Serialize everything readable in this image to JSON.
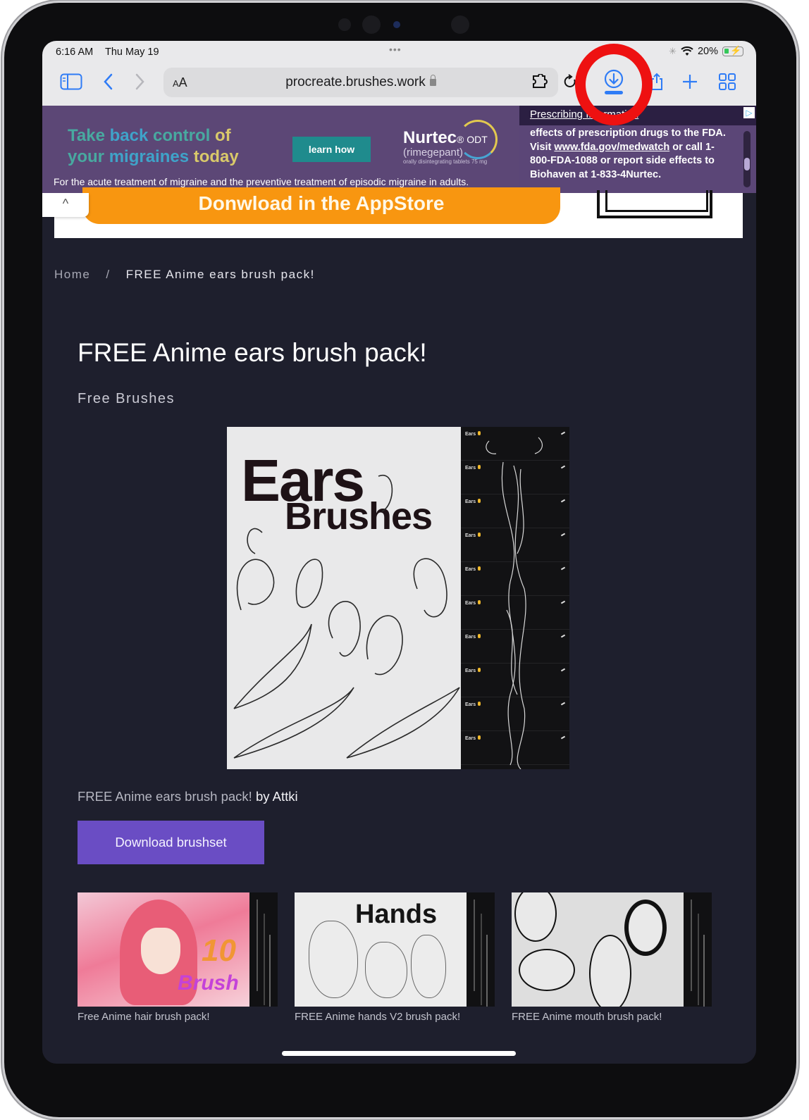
{
  "status_bar": {
    "time": "6:16 AM",
    "date": "Thu May 19",
    "battery_percent": "20%",
    "battery_level": 0.2,
    "charging": true
  },
  "browser": {
    "text_size_label": "AA",
    "url": "procreate.brushes.work",
    "icons": {
      "sidebar": "sidebar-icon",
      "back": "chevron-left-icon",
      "forward": "chevron-right-icon",
      "extensions": "puzzle-icon",
      "reload": "reload-icon",
      "downloads": "download-icon",
      "share": "share-icon",
      "new_tab": "plus-icon",
      "tabs": "tab-grid-icon"
    },
    "highlighted": "downloads",
    "highlight_color": "#ee1111"
  },
  "ad": {
    "headline_line1": [
      "Take ",
      "back ",
      "control ",
      "of"
    ],
    "headline_line2": [
      "your ",
      "migraines ",
      "today"
    ],
    "cta": "learn how",
    "brand": "Nurtec",
    "brand_suffix": "® ODT",
    "generic": "(rimegepant)",
    "dosage": "orally disintegrating tablets 75 mg",
    "disclaimer": "For the acute treatment of migraine and the preventive treatment of episodic migraine in adults.",
    "isi_heading": "Prescribing Information",
    "isi_text_1": "effects of prescription drugs to the FDA. Visit ",
    "isi_link": "www.fda.gov/medwatch",
    "isi_text_2": " or call 1-800-FDA-1088 or report side effects to Biohaven at 1-833-4Nurtec.",
    "adchoices": "▷"
  },
  "app_banner": {
    "label": "Donwload in the AppStore",
    "collapse_icon": "^",
    "color": "#f89610"
  },
  "breadcrumb": {
    "home": "Home",
    "separator": "/",
    "current": "FREE Anime ears brush pack!"
  },
  "page": {
    "title": "FREE Anime ears brush pack!",
    "category": "Free Brushes",
    "hero": {
      "title_word1": "Ears",
      "title_word2": "Brushes",
      "brush_rows": [
        "Ears",
        "Ears",
        "Ears",
        "Ears",
        "Ears",
        "Ears",
        "Ears",
        "Ears",
        "Ears",
        "Ears"
      ]
    },
    "credit_title": "FREE Anime ears brush pack!",
    "credit_by": " by Attki",
    "download_label": "Download brushset",
    "accent_color": "#6a4dc4"
  },
  "related": [
    {
      "caption": "Free Anime hair brush pack!",
      "thumb_text_1": "10",
      "thumb_text_2": "Brush"
    },
    {
      "caption": "FREE Anime hands V2 brush pack!",
      "thumb_text_1": "Hands"
    },
    {
      "caption": "FREE Anime mouth brush pack!"
    }
  ]
}
